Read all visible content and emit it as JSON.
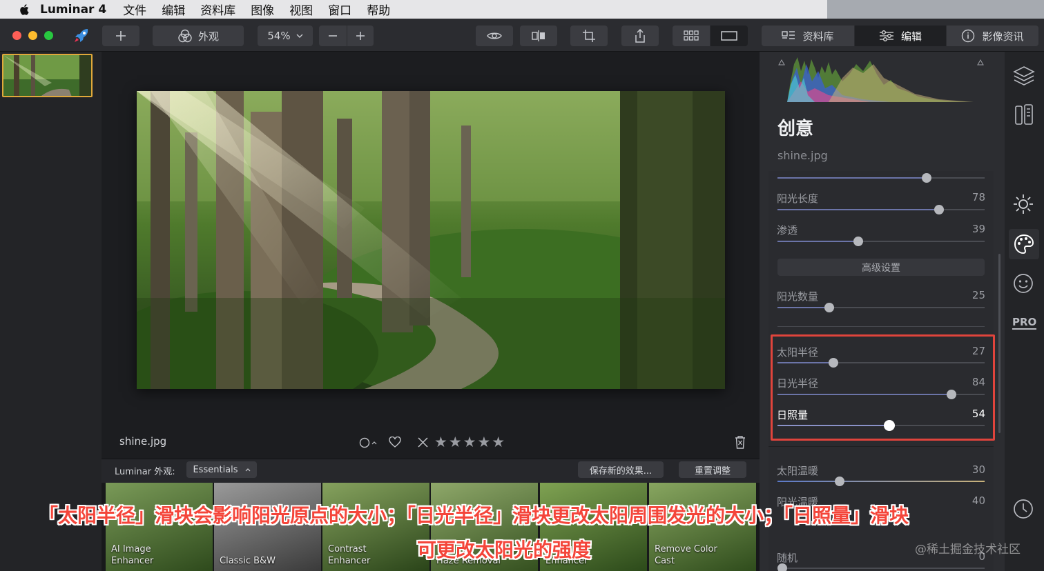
{
  "menubar": {
    "app_name": "Luminar 4",
    "items": [
      "文件",
      "编辑",
      "资料库",
      "图像",
      "视图",
      "窗口",
      "帮助"
    ]
  },
  "toolbar": {
    "add_label": "+",
    "looks_label": "外观",
    "zoom_value": "54%",
    "tabs": {
      "library": "资料库",
      "edit": "编辑",
      "info": "影像资讯"
    }
  },
  "canvas": {
    "filename": "shine.jpg",
    "rating_stars": 5,
    "stars_text": "★★★★★"
  },
  "looks_bar": {
    "label": "Luminar 外观:",
    "preset_select": "Essentials",
    "save_button": "保存新的效果...",
    "reset_button": "重置调整",
    "looks": [
      {
        "label_line1": "AI Image",
        "label_line2": "Enhancer"
      },
      {
        "label_line1": "",
        "label_line2": "Classic B&W"
      },
      {
        "label_line1": "Contrast",
        "label_line2": "Enhancer"
      },
      {
        "label_line1": "",
        "label_line2": "Haze Removal"
      },
      {
        "label_line1": "",
        "label_line2": "Enhancer"
      },
      {
        "label_line1": "Remove Color",
        "label_line2": "Cast"
      }
    ]
  },
  "panel": {
    "title": "创意",
    "filename": "shine.jpg",
    "advanced_button": "高级设置",
    "sliders": [
      {
        "id": "top",
        "label": "",
        "value": "",
        "fraction": 0.72
      },
      {
        "id": "length",
        "label": "阳光长度",
        "value": "78",
        "fraction": 0.78
      },
      {
        "id": "penetration",
        "label": "渗透",
        "value": "39",
        "fraction": 0.39
      },
      {
        "id": "count",
        "label": "阳光数量",
        "value": "25",
        "fraction": 0.25
      },
      {
        "id": "sun_radius",
        "label": "太阳半径",
        "value": "27",
        "fraction": 0.27
      },
      {
        "id": "glow_radius",
        "label": "日光半径",
        "value": "84",
        "fraction": 0.84
      },
      {
        "id": "intensity",
        "label": "日照量",
        "value": "54",
        "fraction": 0.54
      },
      {
        "id": "warmth",
        "label": "太阳温暖",
        "value": "30",
        "fraction": 0.3
      },
      {
        "id": "rays_warmth",
        "label": "阳光温暖",
        "value": "40",
        "fraction": 0.4
      },
      {
        "id": "random",
        "label": "随机",
        "value": "0",
        "fraction": 0.0
      }
    ]
  },
  "side_icons": [
    "layers-icon",
    "canvas-tools-icon",
    "essentials-sun-icon",
    "creative-palette-icon",
    "portrait-face-icon",
    "pro-icon",
    "history-clock-icon"
  ],
  "pro_label": "PRO",
  "caption": {
    "line1": "「太阳半径」滑块会影响阳光原点的大小；「日光半径」滑块更改太阳周围发光的大小；「日照量」滑块",
    "line2": "可更改太阳光的强度"
  },
  "watermark": "@稀土掘金技术社区",
  "colors": {
    "highlight_box": "#e0443c",
    "thumb_border": "#e0a83a",
    "caption": "#f4453a"
  }
}
